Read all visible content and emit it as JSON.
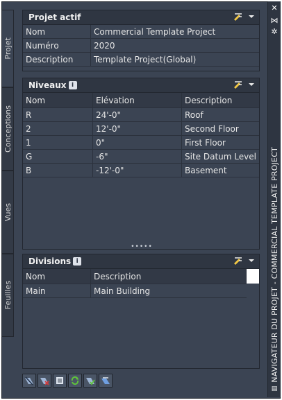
{
  "tabs": [
    "Projet",
    "Conceptions",
    "Vues",
    "Feuilles"
  ],
  "title": "NAVIGATEUR DU PROJET - COMMERCIAL TEMPLATE PROJECT",
  "projet_actif": {
    "title": "Projet actif",
    "rows": [
      {
        "label": "Nom",
        "value": "Commercial Template Project"
      },
      {
        "label": "Numéro",
        "value": "2020"
      },
      {
        "label": "Description",
        "value": "Template Project(Global)"
      }
    ]
  },
  "niveaux": {
    "title": "Niveaux",
    "info": "i",
    "columns": [
      "Nom",
      "Elévation",
      "Description"
    ],
    "rows": [
      [
        "R",
        "24'-0\"",
        "Roof"
      ],
      [
        "2",
        "12'-0\"",
        "Second Floor"
      ],
      [
        "1",
        "0\"",
        "First Floor"
      ],
      [
        "G",
        "-6\"",
        "Site Datum Level"
      ],
      [
        "B",
        "-12'-0\"",
        "Basement"
      ]
    ]
  },
  "splitter": "•••••",
  "divisions": {
    "title": "Divisions",
    "info": "i",
    "columns": [
      "Nom",
      "Description"
    ],
    "rows": [
      [
        "Main",
        "Main Building"
      ]
    ]
  },
  "icons": {
    "close": "close-icon",
    "autohide": "autohide-icon",
    "properties": "properties-icon",
    "settings": "edit-settings-icon",
    "dropdown": "chevron-down-icon"
  },
  "toolbar_icons": [
    "project-browser-icon",
    "close-project-icon",
    "project-properties-icon",
    "refresh-icon",
    "reconcile-icon",
    "repath-icon"
  ]
}
